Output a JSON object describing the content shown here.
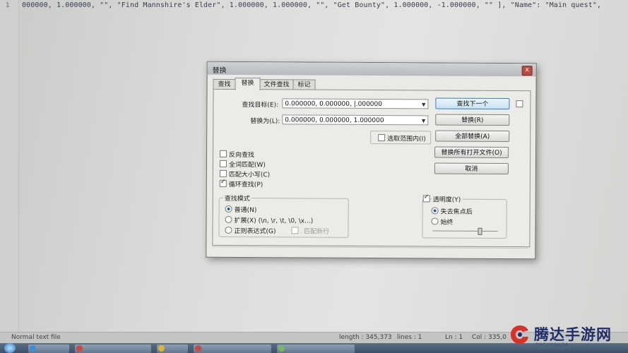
{
  "editor": {
    "line_number": "1",
    "code": "000000, 1.000000, \"\", \"Find Mannshire's Elder\", 1.000000, 1.000000, \"\", \"Get Bounty\", 1.000000, -1.000000, \"\" ], \"Name\": \"Main quest\","
  },
  "statusbar": {
    "file_type": "Normal text file",
    "length": "length : 345,373",
    "lines": "lines : 1",
    "ln": "Ln : 1",
    "col": "Col : 335,0"
  },
  "taskbar": {
    "items": [
      "",
      "",
      "",
      "",
      "",
      ""
    ]
  },
  "watermark": {
    "text": "腾达手游网",
    "sub": "SHOUYOUDA"
  },
  "dialog": {
    "title": "替换",
    "close": "x",
    "tabs": [
      "查找",
      "替换",
      "文件查找",
      "标记"
    ],
    "find_label": "查找目标(E):",
    "find_value": "0.000000, 0.000000, |.000000",
    "replace_label": "替换为(L):",
    "replace_value": "0.000000, 0.000000, 1.000000",
    "in_selection": "选取范围内(I)",
    "buttons": {
      "find_next": "查找下一个",
      "replace": "替换(R)",
      "replace_all": "全部替换(A)",
      "replace_all_open": "替换所有打开文件(O)",
      "cancel": "取消"
    },
    "options": {
      "backward": "反向查找",
      "whole_word": "全词匹配(W)",
      "match_case": "匹配大小写(C)",
      "wrap": "循环查找(P)"
    },
    "search_mode": {
      "title": "查找模式",
      "normal": "普通(N)",
      "extended": "扩展(X) (\\n, \\r, \\t, \\0, \\x...)",
      "regex": "正则表达式(G)",
      "dot_newline": ". 匹配新行"
    },
    "transparency": {
      "title": "透明度(Y)",
      "on_lose_focus": "失去焦点后",
      "always": "始终",
      "level": 0.72
    }
  }
}
